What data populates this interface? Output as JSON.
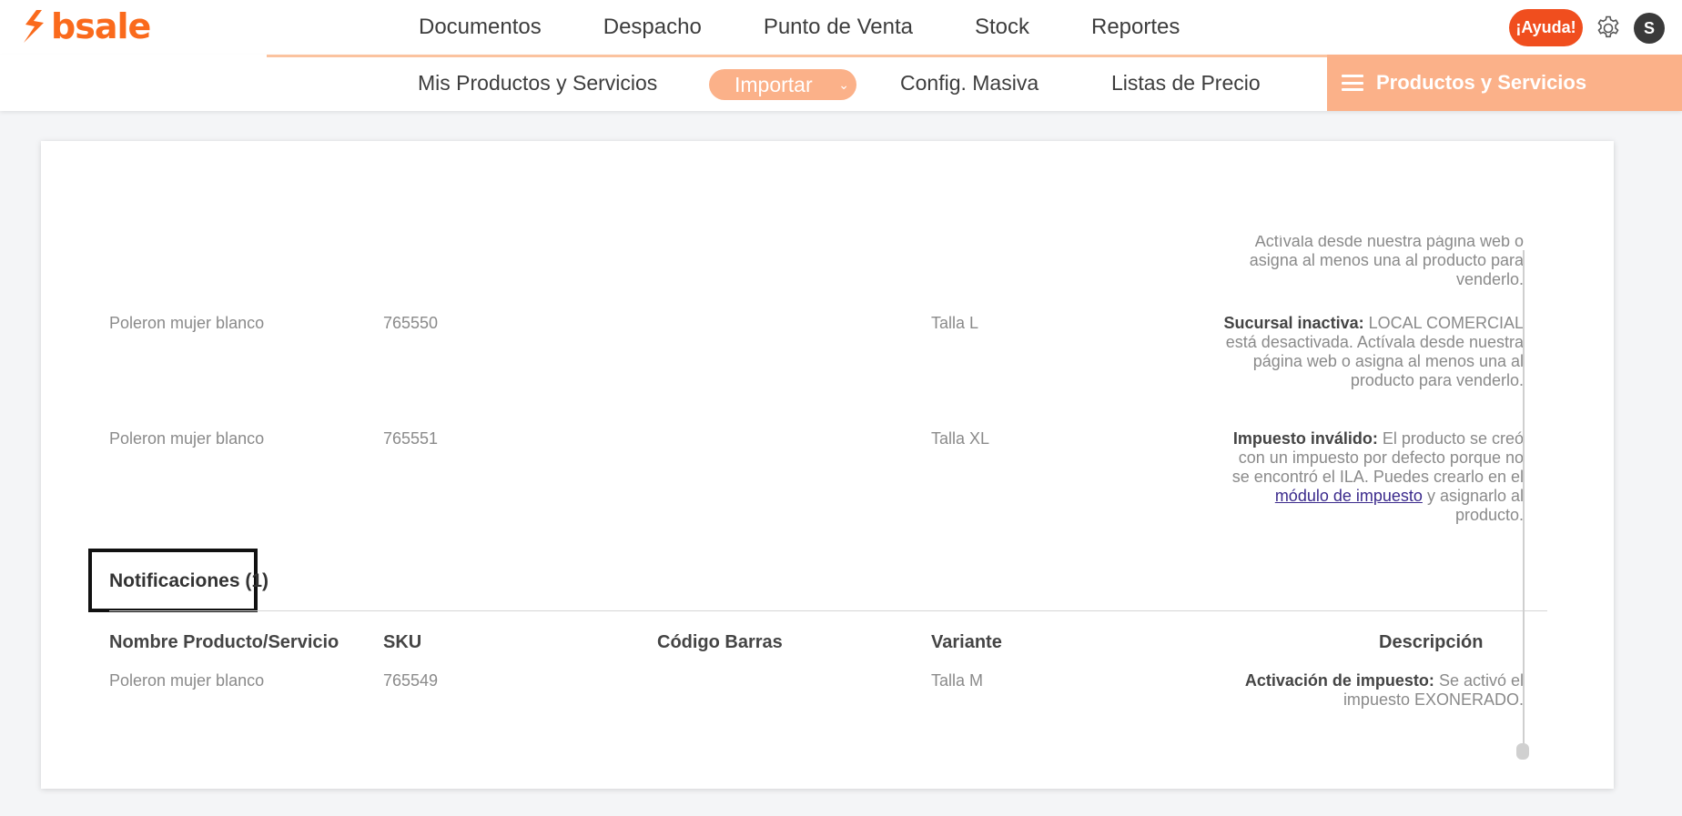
{
  "brand": {
    "name": "bsale",
    "accent": "#fa6a1c"
  },
  "main_nav": {
    "items": [
      "Documentos",
      "Despacho",
      "Punto de Venta",
      "Stock",
      "Reportes"
    ]
  },
  "header_actions": {
    "help_label": "¡Ayuda!",
    "avatar_initial": "S",
    "settings_icon": "gear-icon"
  },
  "sub_nav": {
    "items": [
      "Mis Productos y Servicios",
      "Importar",
      "Config. Masiva",
      "Listas de Precio"
    ],
    "module_label": "Productos y Servicios"
  },
  "errors": {
    "partial_top_text": "Actívala desde nuestra página web o asigna al menos una al producto para venderlo.",
    "rows": [
      {
        "name": "Poleron mujer blanco",
        "sku": "765550",
        "variant": "Talla L",
        "desc_title": "Sucursal inactiva:",
        "desc_text": "LOCAL COMERCIAL está desactivada. Actívala desde nuestra página web o asigna al menos una al producto para venderlo."
      },
      {
        "name": "Poleron mujer blanco",
        "sku": "765551",
        "variant": "Talla XL",
        "desc_title": "Impuesto inválido:",
        "desc_text": "El producto se creó con un impuesto por defecto porque no se encontró el ILA. Puedes crearlo en el",
        "desc_link": "módulo de impuesto",
        "desc_tail": "y asignarlo al producto."
      }
    ]
  },
  "notifications": {
    "tab_label": "Notificaciones (1)",
    "headers": [
      "Nombre Producto/Servicio",
      "SKU",
      "Código Barras",
      "Variante",
      "Descripción"
    ],
    "rows": [
      {
        "name": "Poleron mujer blanco",
        "sku": "765549",
        "barcode": "",
        "variant": "Talla M",
        "desc_title": "Activación de impuesto:",
        "desc_text": "Se activó el impuesto EXONERADO."
      }
    ]
  }
}
